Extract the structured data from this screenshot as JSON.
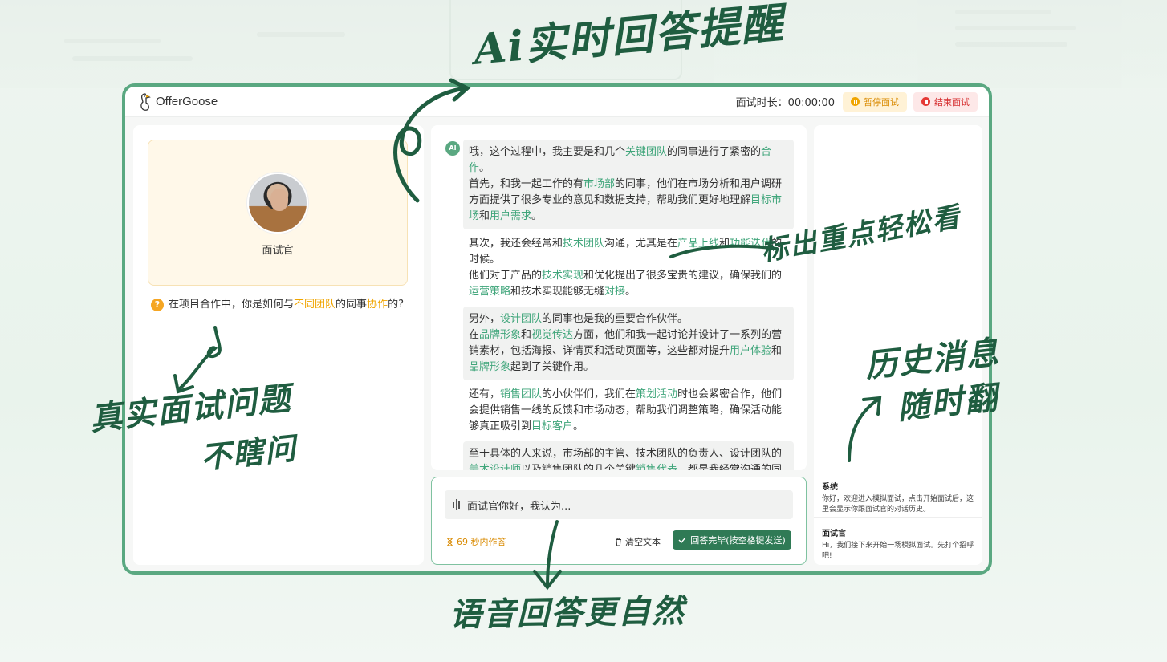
{
  "app": {
    "name": "OfferGoose"
  },
  "header": {
    "timer_label": "面试时长：00:00:00",
    "pause_label": "暂停面试",
    "end_label": "结束面试"
  },
  "left": {
    "interviewer_name": "面试官",
    "question": {
      "part1": "在项目合作中，你是如何与",
      "hl1": "不同团队",
      "part2": "的同事",
      "hl2": "协作",
      "part3": "的?"
    }
  },
  "center": {
    "ai_badge": "AI",
    "messages": [
      {
        "segments": [
          {
            "t": "哦，这个过程中，我主要是和几个"
          },
          {
            "t": "关键团队",
            "hl": 1
          },
          {
            "t": "的同事进行了紧密的"
          },
          {
            "t": "合作",
            "hl": 1
          },
          {
            "t": "。"
          },
          {
            "br": 1
          },
          {
            "t": "首先，和我一起工作的有"
          },
          {
            "t": "市场部",
            "hl": 1
          },
          {
            "t": "的同事，他们在市场分析和用户调研方面提供了很多专业的意见和数据支持，帮助我们更好地理解"
          },
          {
            "t": "目标市场",
            "hl": 1
          },
          {
            "t": "和"
          },
          {
            "t": "用户需求",
            "hl": 1
          },
          {
            "t": "。"
          }
        ]
      },
      {
        "segments": [
          {
            "t": "其次，我还会经常和"
          },
          {
            "t": "技术团队",
            "hl": 1
          },
          {
            "t": "沟通，尤其是在"
          },
          {
            "t": "产品上线",
            "hl": 1
          },
          {
            "t": "和"
          },
          {
            "t": "功能迭代",
            "hl": 1
          },
          {
            "t": "的时候。"
          },
          {
            "br": 1
          },
          {
            "t": "他们对于产品的"
          },
          {
            "t": "技术实现",
            "hl": 1
          },
          {
            "t": "和优化提出了很多宝贵的建议，确保我们的"
          },
          {
            "t": "运营策略",
            "hl": 1
          },
          {
            "t": "和技术实现能够无缝"
          },
          {
            "t": "对接",
            "hl": 1
          },
          {
            "t": "。"
          }
        ]
      },
      {
        "segments": [
          {
            "t": "另外，"
          },
          {
            "t": "设计团队",
            "hl": 1
          },
          {
            "t": "的同事也是我的重要合作伙伴。"
          },
          {
            "br": 1
          },
          {
            "t": "在"
          },
          {
            "t": "品牌形象",
            "hl": 1
          },
          {
            "t": "和"
          },
          {
            "t": "视觉传达",
            "hl": 1
          },
          {
            "t": "方面，他们和我一起讨论并设计了一系列的营销素材，包括海报、详情页和活动页面等，这些都对提升"
          },
          {
            "t": "用户体验",
            "hl": 1
          },
          {
            "t": "和"
          },
          {
            "t": "品牌形象",
            "hl": 1
          },
          {
            "t": "起到了关键作用。"
          }
        ]
      },
      {
        "segments": [
          {
            "t": "还有，"
          },
          {
            "t": "销售团队",
            "hl": 1
          },
          {
            "t": "的小伙伴们，我们在"
          },
          {
            "t": "策划活动",
            "hl": 1
          },
          {
            "t": "时也会紧密合作，他们会提供销售一线的反馈和市场动态，帮助我们调整策略，确保活动能够真正吸引到"
          },
          {
            "t": "目标客户",
            "hl": 1
          },
          {
            "t": "。"
          }
        ]
      },
      {
        "segments": [
          {
            "t": "至于具体的人来说，市场部的主管、技术团队的负责人、设计团队的"
          },
          {
            "t": "美术设计师",
            "hl": 1
          },
          {
            "t": "以及销售团队的几个关键"
          },
          {
            "t": "销售代表",
            "hl": 1
          },
          {
            "t": "，都是我经常沟通的同事。"
          }
        ]
      }
    ]
  },
  "input": {
    "text": "面试官你好，我认为...",
    "countdown": "69 秒内作答",
    "clear_label": "清空文本",
    "submit_label": "回答完毕(按空格键发送)"
  },
  "history": [
    {
      "title": "系统",
      "text": "你好，欢迎进入模拟面试，点击开始面试后，这里会显示你跟面试官的对话历史。"
    },
    {
      "title": "面试官",
      "text": "Hi，我们接下来开始一场模拟面试。先打个招呼吧!"
    }
  ],
  "annotations": {
    "top": "Ai实时回答提醒",
    "right_mid": "标出重点轻松看",
    "left_bottom_1": "真实面试问题",
    "left_bottom_2": "不瞎问",
    "right_bottom_1": "历史消息",
    "right_bottom_2": "随时翻",
    "bottom": "语音回答更自然"
  },
  "colors": {
    "brand": "#5aa881",
    "highlight": "#3fa57a",
    "accent": "#f0a500",
    "danger": "#e53935",
    "ink": "#1f5d40"
  }
}
